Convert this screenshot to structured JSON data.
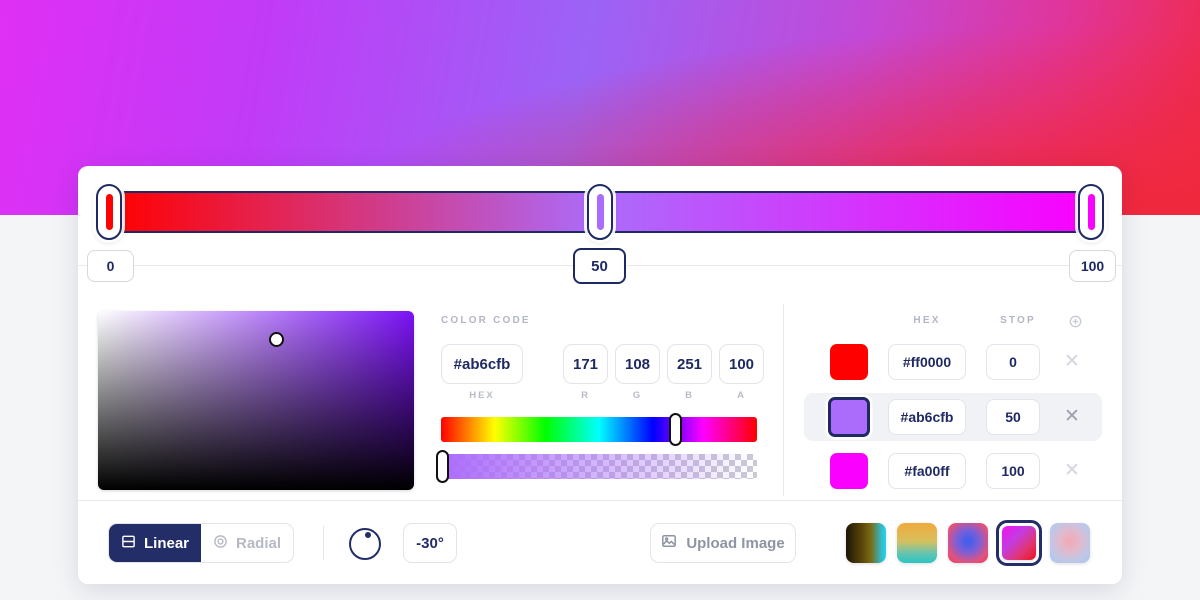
{
  "background": {
    "hero_gradient": [
      "#e02ff5",
      "#9b63f6",
      "#f02a4a"
    ],
    "page_bg": "#f4f5f7"
  },
  "gradient_bar": {
    "css": "linear-gradient(90deg, #ff0000 0%, #ab6cfb 50%, #fa00ff 100%)",
    "handles": [
      {
        "name": "handle-0",
        "stop": "0",
        "color": "#ff0000",
        "selected": false
      },
      {
        "name": "handle-50",
        "stop": "50",
        "color": "#ab6cfb",
        "selected": true
      },
      {
        "name": "handle-100",
        "stop": "100",
        "color": "#fa00ff",
        "selected": false
      }
    ],
    "stop_values": {
      "start": "0",
      "middle": "50",
      "end": "100"
    }
  },
  "color_code": {
    "section_label": "COLOR CODE",
    "hex_value": "#ab6cfb",
    "hex_sublabel": "HEX",
    "r_value": "171",
    "r_sublabel": "R",
    "g_value": "108",
    "g_sublabel": "G",
    "b_value": "251",
    "b_sublabel": "B",
    "a_value": "100",
    "a_sublabel": "A"
  },
  "picker": {
    "current_color": "#ab6cfb",
    "base_hue_color": "#7b12f5",
    "hue_position_pct": 74,
    "alpha_position_pct": 0
  },
  "stop_list": {
    "header_hex": "HEX",
    "header_stop": "STOP",
    "add_icon": "add-circle-icon",
    "delete_icon": "close-icon",
    "rows": [
      {
        "color": "#ff0000",
        "hex": "#ff0000",
        "stop": "0",
        "selected": false
      },
      {
        "color": "#ab6cfb",
        "hex": "#ab6cfb",
        "stop": "50",
        "selected": true
      },
      {
        "color": "#fa00ff",
        "hex": "#fa00ff",
        "stop": "100",
        "selected": false
      }
    ]
  },
  "footer": {
    "linear_label": "Linear",
    "linear_icon": "linear-gradient-icon",
    "radial_label": "Radial",
    "radial_icon": "radial-gradient-icon",
    "active_type": "Linear",
    "angle_value": "-30°",
    "angle_dial_icon": "angle-dial-icon",
    "upload_label": "Upload Image",
    "upload_icon": "image-icon",
    "presets": [
      {
        "name": "preset-brown-cyan",
        "css": "linear-gradient(90deg,#1d1405 0%,#5d4a09 42%,#7a6a14 62%,#33b9c9 88%,#22d3ee 100%)",
        "selected": false
      },
      {
        "name": "preset-orange-teal",
        "css": "linear-gradient(180deg,#f0a93c 0%,#d8c05e 45%,#5fc4b4 78%,#2cc5c0 100%)",
        "selected": false
      },
      {
        "name": "preset-blue-pink-radial",
        "css": "radial-gradient(circle at 50% 45%, #3b5ef0 0%, #7b5fd6 38%, #e0537f 72%, #ef3b54 100%)",
        "selected": false
      },
      {
        "name": "preset-magenta-red",
        "css": "linear-gradient(135deg,#f012f0 0%,#c43ce0 38%,#e0356f 70%,#ee1122 100%)",
        "selected": true
      },
      {
        "name": "preset-soft-pink-blue",
        "css": "radial-gradient(circle at 50% 45%, #f3a8b4 0%, #e2b9cc 35%, #bcc8e8 70%, #aec4e6 100%)",
        "selected": false
      }
    ]
  }
}
